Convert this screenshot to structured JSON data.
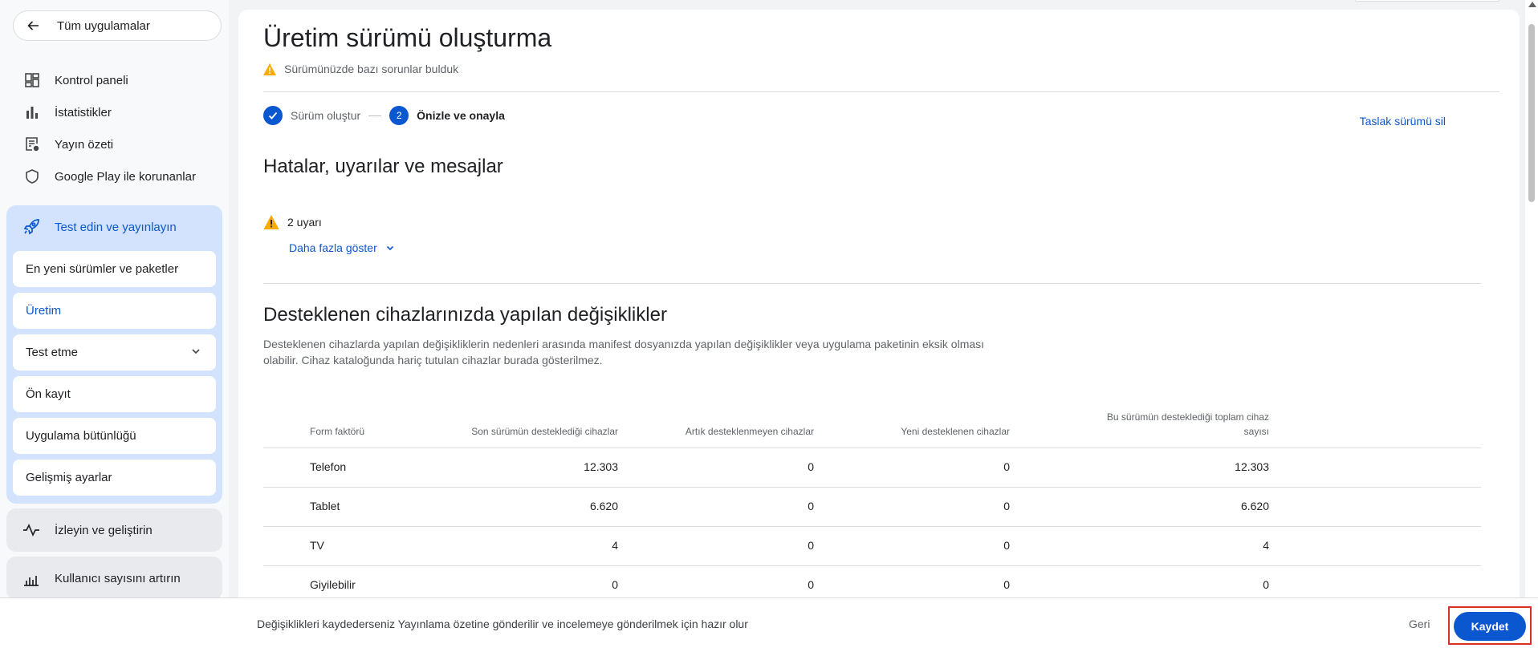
{
  "sidebar": {
    "back_label": "Tüm uygulamalar",
    "items": [
      {
        "label": "Kontrol paneli",
        "icon": "dashboard-icon"
      },
      {
        "label": "İstatistikler",
        "icon": "bar-chart-icon"
      },
      {
        "label": "Yayın özeti",
        "icon": "publishing-overview-icon"
      },
      {
        "label": "Google Play ile korunanlar",
        "icon": "shield-icon"
      }
    ],
    "test_release_group": {
      "label": "Test edin ve yayınlayın",
      "icon": "rocket-icon",
      "children": [
        {
          "label": "En yeni sürümler ve paketler"
        },
        {
          "label": "Üretim",
          "active": true
        },
        {
          "label": "Test etme",
          "expandable": true
        },
        {
          "label": "Ön kayıt"
        },
        {
          "label": "Uygulama bütünlüğü"
        },
        {
          "label": "Gelişmiş ayarlar"
        }
      ]
    },
    "monitor_group": {
      "label": "İzleyin ve geliştirin",
      "icon": "pulse-icon"
    },
    "grow_group": {
      "label": "Kullanıcı sayısını artırın",
      "icon": "growth-chart-icon"
    }
  },
  "main": {
    "title": "Üretim sürümü oluşturma",
    "warning_summary": "Sürümünüzde bazı sorunlar bulduk",
    "stepper": {
      "step1_label": "Sürüm oluştur",
      "step2_number": "2",
      "step2_label": "Önizle ve onayla"
    },
    "delete_draft_label": "Taslak sürümü sil",
    "errors_section": {
      "title": "Hatalar, uyarılar ve mesajlar",
      "warning_count": "2 uyarı",
      "show_more": "Daha fazla göster"
    },
    "devices_section": {
      "title": "Desteklenen cihazlarınızda yapılan değişiklikler",
      "description": "Desteklenen cihazlarda yapılan değişikliklerin nedenleri arasında manifest dosyanızda yapılan değişiklikler veya uygulama paketinin eksik olması olabilir. Cihaz kataloğunda hariç tutulan cihazlar burada gösterilmez.",
      "columns": [
        "Form faktörü",
        "Son sürümün desteklediği cihazlar",
        "Artık desteklenmeyen cihazlar",
        "Yeni desteklenen cihazlar",
        "Bu sürümün desteklediği toplam cihaz sayısı"
      ],
      "rows": [
        [
          "Telefon",
          "12.303",
          "0",
          "0",
          "12.303"
        ],
        [
          "Tablet",
          "6.620",
          "0",
          "0",
          "6.620"
        ],
        [
          "TV",
          "4",
          "0",
          "0",
          "4"
        ],
        [
          "Giyilebilir",
          "0",
          "0",
          "0",
          "0"
        ]
      ]
    }
  },
  "bottom_bar": {
    "message": "Değişiklikleri kaydederseniz Yayınlama özetine gönderilir ve incelemeye gönderilmek için hazır olur",
    "back_label": "Geri",
    "save_label": "Kaydet"
  },
  "colors": {
    "accent": "#0b57d0",
    "active_group_bg": "#d3e3fd",
    "warning": "#f9ab00",
    "highlight_border": "#d93025"
  }
}
